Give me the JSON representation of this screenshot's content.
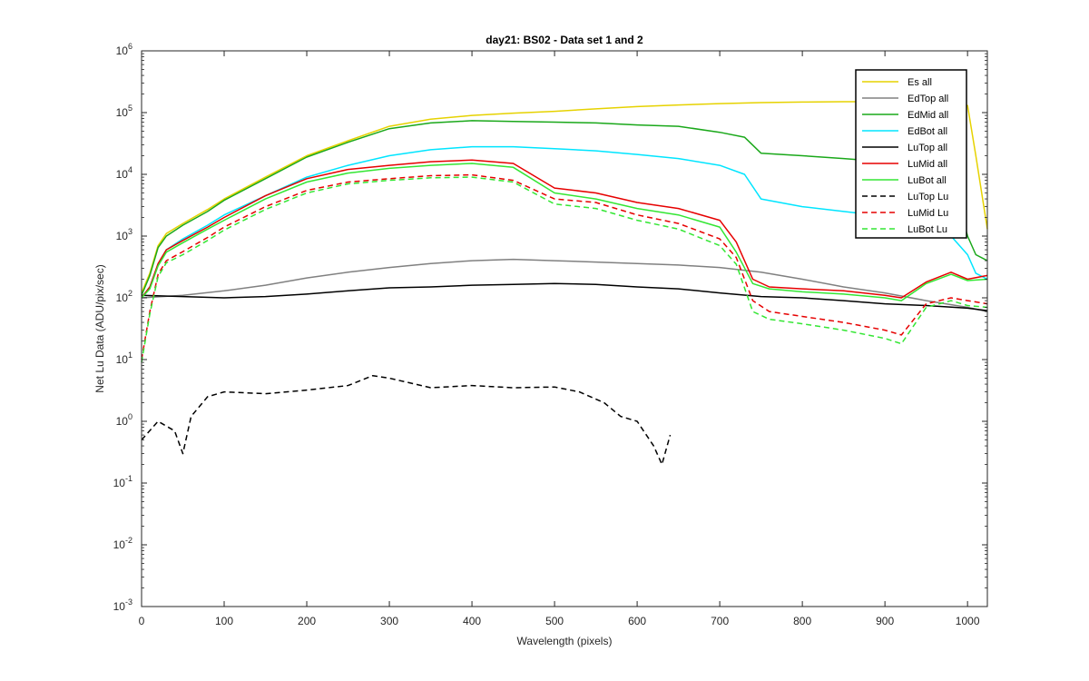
{
  "chart_data": {
    "type": "line",
    "title": "day21: BS02 - Data set 1 and 2",
    "xlabel": "Wavelength (pixels)",
    "ylabel": "Net Lu Data (ADU/pix/sec)",
    "xlim": [
      0,
      1024
    ],
    "ylim": [
      0.001,
      1000000
    ],
    "yscale": "log",
    "grid": false,
    "legend_position": "top-right",
    "x_ticks": [
      "0",
      "100",
      "200",
      "300",
      "400",
      "500",
      "600",
      "700",
      "800",
      "900",
      "1000"
    ],
    "y_ticks": [
      {
        "base": "10",
        "exp": "-3"
      },
      {
        "base": "10",
        "exp": "-2"
      },
      {
        "base": "10",
        "exp": "-1"
      },
      {
        "base": "10",
        "exp": "0"
      },
      {
        "base": "10",
        "exp": "1"
      },
      {
        "base": "10",
        "exp": "2"
      },
      {
        "base": "10",
        "exp": "3"
      },
      {
        "base": "10",
        "exp": "4"
      },
      {
        "base": "10",
        "exp": "5"
      },
      {
        "base": "10",
        "exp": "6"
      }
    ],
    "series": [
      {
        "name": "Es  all",
        "color": "#e6d200",
        "dash": "solid",
        "x": [
          0,
          10,
          20,
          30,
          50,
          80,
          100,
          150,
          200,
          250,
          300,
          350,
          400,
          450,
          500,
          550,
          600,
          650,
          700,
          750,
          800,
          850,
          900,
          950,
          1000,
          1010,
          1024
        ],
        "y": [
          120,
          250,
          700,
          1100,
          1600,
          2700,
          4000,
          9000,
          20000,
          35000,
          60000,
          78000,
          90000,
          98000,
          105000,
          115000,
          125000,
          133000,
          140000,
          145000,
          148000,
          150000,
          150000,
          150000,
          130000,
          20000,
          1300
        ]
      },
      {
        "name": "EdTop  all",
        "color": "#808080",
        "dash": "solid",
        "x": [
          0,
          50,
          100,
          150,
          200,
          250,
          300,
          350,
          400,
          450,
          500,
          550,
          600,
          650,
          700,
          750,
          800,
          850,
          900,
          950,
          1000,
          1024
        ],
        "y": [
          100,
          110,
          130,
          160,
          210,
          260,
          310,
          360,
          400,
          420,
          400,
          380,
          360,
          340,
          310,
          260,
          200,
          150,
          120,
          90,
          70,
          60
        ]
      },
      {
        "name": "EdMid  all",
        "color": "#1aa81a",
        "dash": "solid",
        "x": [
          0,
          10,
          20,
          30,
          50,
          80,
          100,
          150,
          200,
          250,
          300,
          350,
          400,
          450,
          500,
          550,
          600,
          650,
          700,
          730,
          750,
          800,
          850,
          900,
          950,
          980,
          1000,
          1010,
          1024
        ],
        "y": [
          110,
          230,
          650,
          1000,
          1500,
          2500,
          3800,
          8500,
          19000,
          33000,
          55000,
          68000,
          74000,
          72000,
          70000,
          68000,
          63000,
          60000,
          48000,
          40000,
          22000,
          20000,
          18000,
          16000,
          14000,
          9000,
          1000,
          500,
          400
        ]
      },
      {
        "name": "EdBot  all",
        "color": "#00e5ff",
        "dash": "solid",
        "x": [
          0,
          10,
          20,
          30,
          50,
          80,
          100,
          150,
          200,
          250,
          300,
          350,
          400,
          450,
          500,
          550,
          600,
          650,
          700,
          730,
          750,
          800,
          850,
          900,
          950,
          980,
          1000,
          1010,
          1024
        ],
        "y": [
          100,
          150,
          350,
          600,
          900,
          1500,
          2200,
          4500,
          9000,
          14000,
          20000,
          25000,
          28000,
          28000,
          26000,
          24000,
          21000,
          18000,
          14000,
          10000,
          4000,
          3000,
          2500,
          2100,
          1600,
          1000,
          500,
          250,
          200
        ]
      },
      {
        "name": "LuTop  all",
        "color": "#000000",
        "dash": "solid",
        "x": [
          0,
          50,
          100,
          150,
          200,
          250,
          300,
          350,
          400,
          450,
          500,
          550,
          600,
          650,
          700,
          750,
          800,
          850,
          900,
          950,
          1000,
          1024
        ],
        "y": [
          110,
          105,
          100,
          105,
          115,
          130,
          145,
          150,
          160,
          165,
          170,
          165,
          150,
          140,
          120,
          105,
          100,
          90,
          80,
          75,
          68,
          62
        ]
      },
      {
        "name": "LuMid  all",
        "color": "#e60000",
        "dash": "solid",
        "x": [
          0,
          10,
          20,
          30,
          50,
          80,
          100,
          150,
          200,
          250,
          300,
          350,
          400,
          450,
          500,
          550,
          600,
          650,
          700,
          720,
          740,
          760,
          800,
          850,
          900,
          920,
          950,
          980,
          1000,
          1024
        ],
        "y": [
          100,
          150,
          360,
          600,
          850,
          1400,
          2000,
          4500,
          8500,
          12000,
          14000,
          16000,
          17000,
          15000,
          6000,
          5000,
          3500,
          2800,
          1800,
          800,
          200,
          150,
          140,
          130,
          110,
          100,
          180,
          260,
          200,
          230
        ]
      },
      {
        "name": "LuBot  all",
        "color": "#33e633",
        "dash": "solid",
        "x": [
          0,
          10,
          20,
          30,
          50,
          80,
          100,
          150,
          200,
          250,
          300,
          350,
          400,
          450,
          500,
          550,
          600,
          650,
          700,
          720,
          740,
          760,
          800,
          850,
          900,
          920,
          950,
          980,
          1000,
          1024
        ],
        "y": [
          100,
          140,
          330,
          550,
          780,
          1300,
          1800,
          4000,
          7500,
          10500,
          12500,
          14000,
          15000,
          13000,
          5000,
          4000,
          2800,
          2200,
          1400,
          550,
          170,
          140,
          125,
          115,
          100,
          90,
          170,
          240,
          190,
          200
        ]
      },
      {
        "name": "LuTop  Lu",
        "color": "#000000",
        "dash": "dashed",
        "x": [
          0,
          20,
          40,
          50,
          60,
          80,
          100,
          150,
          200,
          250,
          280,
          300,
          350,
          400,
          450,
          500,
          530,
          560,
          580,
          600,
          620,
          630,
          640
        ],
        "y": [
          0.5,
          1.0,
          0.7,
          0.3,
          1.2,
          2.5,
          3.0,
          2.8,
          3.2,
          3.8,
          5.5,
          5.0,
          3.5,
          3.8,
          3.5,
          3.6,
          3.0,
          2.0,
          1.2,
          1.0,
          0.4,
          0.2,
          0.6
        ]
      },
      {
        "name": "LuMid  Lu",
        "color": "#e60000",
        "dash": "dashed",
        "x": [
          0,
          10,
          20,
          30,
          50,
          80,
          100,
          150,
          200,
          250,
          300,
          350,
          400,
          450,
          500,
          550,
          600,
          650,
          700,
          720,
          740,
          760,
          800,
          850,
          900,
          920,
          950,
          980,
          1000,
          1024
        ],
        "y": [
          10,
          60,
          240,
          400,
          560,
          950,
          1400,
          3000,
          5500,
          7500,
          8500,
          9500,
          9800,
          8000,
          4000,
          3500,
          2200,
          1600,
          900,
          450,
          90,
          60,
          50,
          40,
          30,
          25,
          80,
          100,
          90,
          80
        ]
      },
      {
        "name": "LuBot  Lu",
        "color": "#33e633",
        "dash": "dashed",
        "x": [
          0,
          10,
          20,
          30,
          50,
          80,
          100,
          150,
          200,
          250,
          300,
          350,
          400,
          450,
          500,
          550,
          600,
          650,
          700,
          720,
          740,
          760,
          800,
          850,
          900,
          920,
          950,
          980,
          1000,
          1024
        ],
        "y": [
          9,
          55,
          220,
          370,
          500,
          850,
          1250,
          2700,
          5000,
          7000,
          8000,
          8800,
          9000,
          7500,
          3300,
          2800,
          1800,
          1300,
          700,
          350,
          60,
          45,
          38,
          30,
          22,
          18,
          70,
          90,
          75,
          70
        ]
      }
    ]
  }
}
